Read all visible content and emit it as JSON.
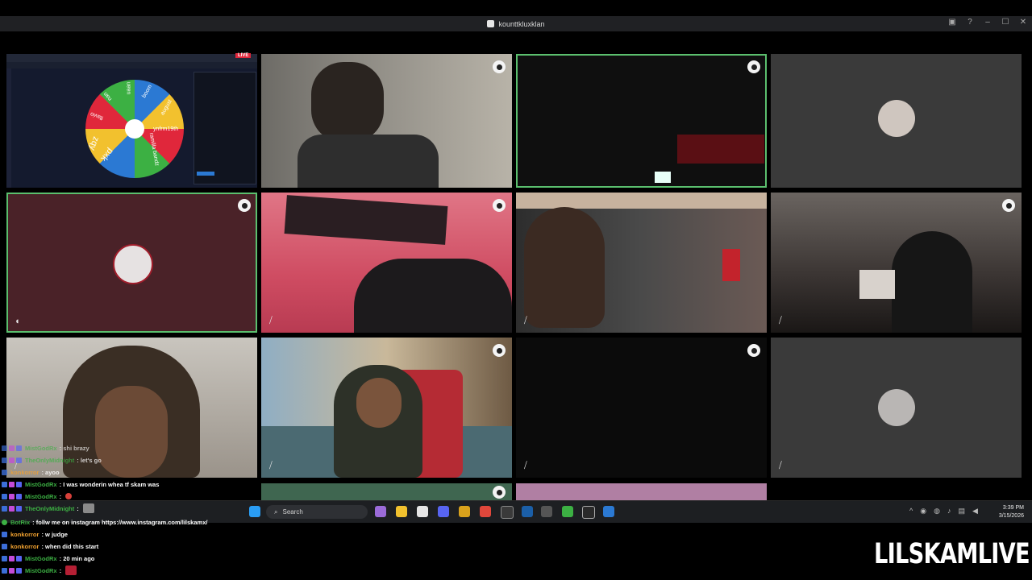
{
  "window": {
    "title": "kounttkluxklan"
  },
  "stream": {
    "live_badge": "LIVE",
    "brand": "LILSKAMLIVE"
  },
  "wheel": {
    "labels": [
      "august",
      "ynfrm19th",
      "ramilla bandz",
      "zqy",
      "pxk",
      "flavio",
      "nan",
      "uaan",
      "boom"
    ]
  },
  "taskbar": {
    "search_label": "Search",
    "time": "3:39 PM",
    "date": "3/15/2026"
  },
  "chat": [
    {
      "user": "MistGodRx",
      "user_color": "#3cb043",
      "text": "shi brazy"
    },
    {
      "user": "TheOnlyMidnight",
      "user_color": "#3cb043",
      "text": "let's go"
    },
    {
      "user": "konkorror",
      "user_color": "#f2a230",
      "text": "ayoo"
    },
    {
      "user": "MistGodRx",
      "user_color": "#3cb043",
      "text": "I was wonderin whea tf skam was"
    },
    {
      "user": "MistGodRx",
      "user_color": "#3cb043",
      "text": ""
    },
    {
      "user": "TheOnlyMidnight",
      "user_color": "#3cb043",
      "text": ""
    },
    {
      "user": "BotRix",
      "user_color": "#3cb043",
      "text": "follw me on instagram https://www.instagram.com/lilskamx/"
    },
    {
      "user": "konkorror",
      "user_color": "#f2a230",
      "text": "w judge"
    },
    {
      "user": "konkorror",
      "user_color": "#f2a230",
      "text": "when did this start"
    },
    {
      "user": "MistGodRx",
      "user_color": "#3cb043",
      "text": "20 min ago"
    },
    {
      "user": "MistGodRx",
      "user_color": "#3cb043",
      "text": ""
    }
  ],
  "colors": {
    "accent_green": "#5bbf6e",
    "tile_bg": "#3a3a3a",
    "taskbar_bg": "#1d1f22"
  }
}
